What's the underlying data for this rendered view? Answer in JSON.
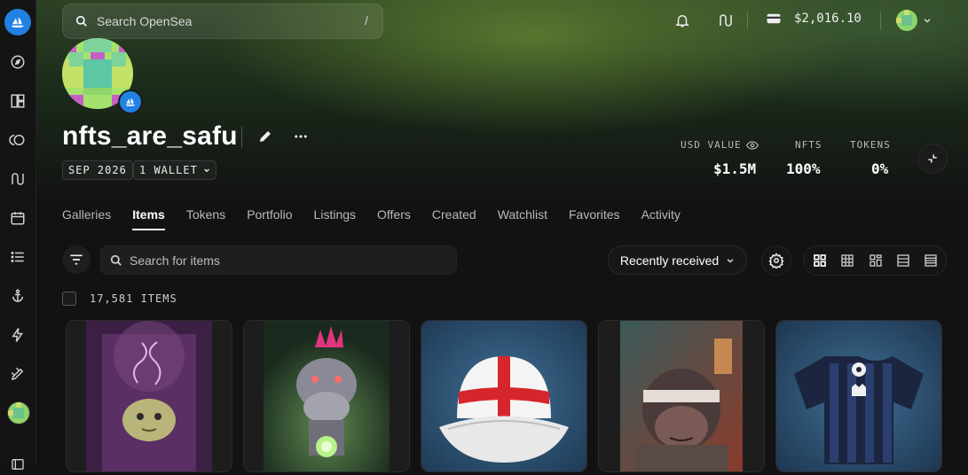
{
  "search": {
    "placeholder": "Search OpenSea",
    "shortcut": "/"
  },
  "wallet": {
    "balance": "$2,016.10"
  },
  "profile": {
    "username": "nfts_are_safu",
    "joined": "SEP 2026",
    "wallets_label": "1 WALLET"
  },
  "stats": [
    {
      "label": "USD VALUE",
      "value": "$1.5M"
    },
    {
      "label": "NFTS",
      "value": "100%"
    },
    {
      "label": "TOKENS",
      "value": "0%"
    }
  ],
  "tabs": [
    "Galleries",
    "Items",
    "Tokens",
    "Portfolio",
    "Listings",
    "Offers",
    "Created",
    "Watchlist",
    "Favorites",
    "Activity"
  ],
  "active_tab": "Items",
  "items": {
    "search_placeholder": "Search for items",
    "sort_label": "Recently received",
    "count_label": "17,581 ITEMS"
  },
  "sidebar_icons": [
    "opensea-logo-icon",
    "compass-icon",
    "grid-layout-icon",
    "swap-circles-icon",
    "bridge-icon",
    "calendar-icon",
    "list-icon",
    "anchor-icon",
    "lightning-icon",
    "pencil-tool-icon",
    "user-avatar",
    "wallet-icon"
  ],
  "cards": [
    "pufferfish-nft",
    "pink-mohawk-rhino-nft",
    "england-cap-nft",
    "blindfolded-ape-nft",
    "striped-jersey-nft"
  ],
  "colors": {
    "accent": "#2081e2",
    "background": "#121212"
  }
}
